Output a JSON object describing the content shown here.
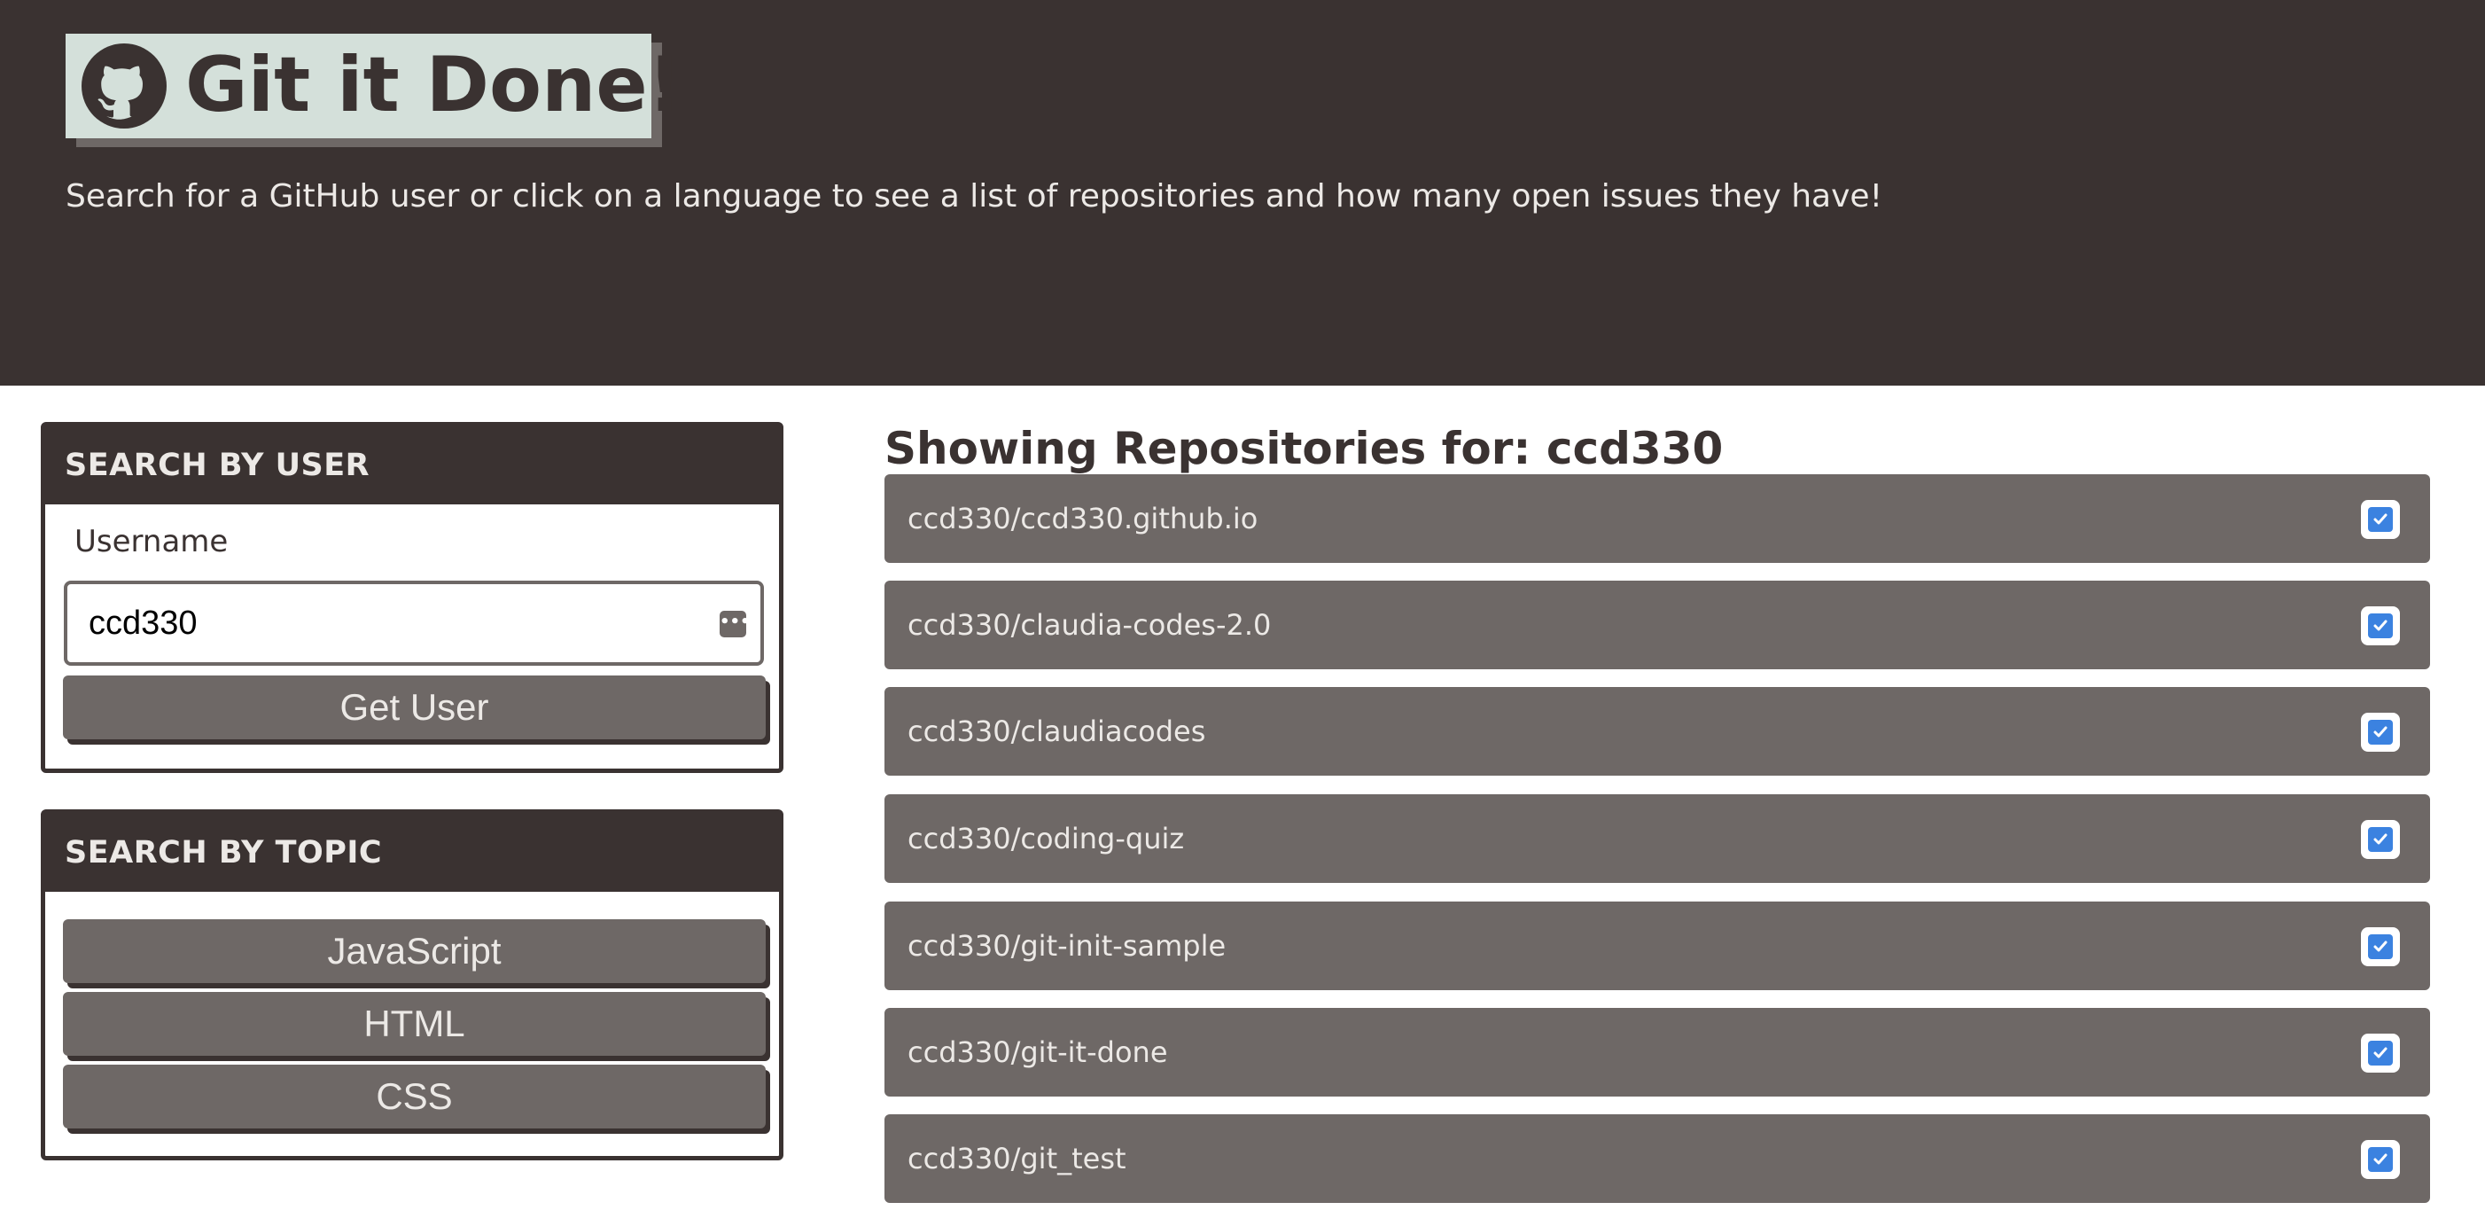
{
  "header": {
    "title": "Git it Done!",
    "logo_icon": "github-octocat-icon",
    "subtitle": "Search for a GitHub user or click on a language to see a list of repositories and how many open issues they have!"
  },
  "search_user": {
    "heading": "SEARCH BY USER",
    "label": "Username",
    "username_value": "ccd330",
    "password_manager_icon": "password-manager-icon",
    "button_label": "Get User"
  },
  "search_topic": {
    "heading": "SEARCH BY TOPIC",
    "topics": [
      {
        "label": "JavaScript"
      },
      {
        "label": "HTML"
      },
      {
        "label": "CSS"
      }
    ]
  },
  "repos": {
    "heading": "Showing Repositories for: ccd330",
    "items": [
      {
        "name": "ccd330/ccd330.github.io",
        "status_icon": "check-square-icon"
      },
      {
        "name": "ccd330/claudia-codes-2.0",
        "status_icon": "check-square-icon"
      },
      {
        "name": "ccd330/claudiacodes",
        "status_icon": "check-square-icon"
      },
      {
        "name": "ccd330/coding-quiz",
        "status_icon": "check-square-icon"
      },
      {
        "name": "ccd330/git-init-sample",
        "status_icon": "check-square-icon"
      },
      {
        "name": "ccd330/git-it-done",
        "status_icon": "check-square-icon"
      },
      {
        "name": "ccd330/git_test",
        "status_icon": "check-square-icon"
      }
    ]
  },
  "colors": {
    "header_bg": "#3a3231",
    "logo_bg": "#d4e0da",
    "item_bg": "#6e6866",
    "check_blue": "#3b82e0",
    "text_light": "#ece9e6"
  }
}
